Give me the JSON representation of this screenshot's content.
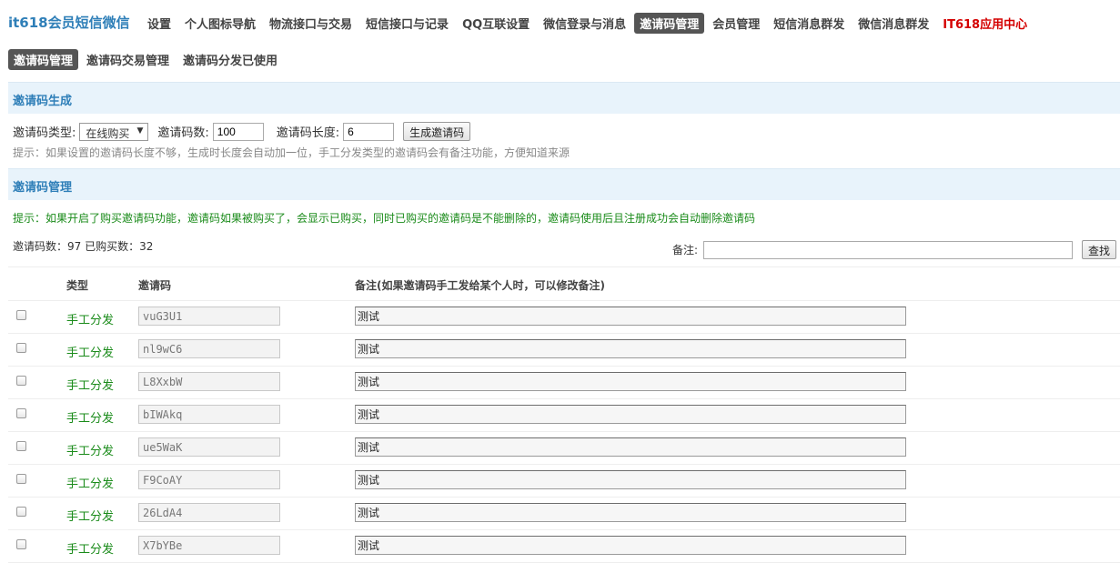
{
  "brand": "it618会员短信微信",
  "nav": [
    {
      "label": "设置",
      "active": false
    },
    {
      "label": "个人图标导航",
      "active": false
    },
    {
      "label": "物流接口与交易",
      "active": false
    },
    {
      "label": "短信接口与记录",
      "active": false
    },
    {
      "label": "QQ互联设置",
      "active": false
    },
    {
      "label": "微信登录与消息",
      "active": false
    },
    {
      "label": "邀请码管理",
      "active": true
    },
    {
      "label": "会员管理",
      "active": false
    },
    {
      "label": "短信消息群发",
      "active": false
    },
    {
      "label": "微信消息群发",
      "active": false
    },
    {
      "label": "IT618应用中心",
      "active": false,
      "highlight": true
    }
  ],
  "subtabs": [
    {
      "label": "邀请码管理",
      "active": true
    },
    {
      "label": "邀请码交易管理",
      "active": false
    },
    {
      "label": "邀请码分发已使用",
      "active": false
    }
  ],
  "generate": {
    "title": "邀请码生成",
    "type_label": "邀请码类型:",
    "type_value": "在线购买",
    "count_label": "邀请码数:",
    "count_value": "100",
    "length_label": "邀请码长度:",
    "length_value": "6",
    "button": "生成邀请码",
    "hint": "提示：如果设置的邀请码长度不够，生成时长度会自动加一位，手工分发类型的邀请码会有备注功能，方便知道来源"
  },
  "manage": {
    "title": "邀请码管理",
    "hint": "提示：如果开启了购买邀请码功能，邀请码如果被购买了，会显示已购买，同时已购买的邀请码是不能删除的，邀请码使用后且注册成功会自动删除邀请码",
    "counts": "邀请码数：97 已购买数：32",
    "remark_label": "备注:",
    "remark_value": "",
    "search_button": "查找"
  },
  "table": {
    "headers": {
      "type": "类型",
      "code": "邀请码",
      "note": "备注(如果邀请码手工发给某个人时，可以修改备注)"
    },
    "rows": [
      {
        "type": "手工分发",
        "code": "vuG3U1",
        "note": "测试"
      },
      {
        "type": "手工分发",
        "code": "nl9wC6",
        "note": "测试"
      },
      {
        "type": "手工分发",
        "code": "L8XxbW",
        "note": "测试"
      },
      {
        "type": "手工分发",
        "code": "bIWAkq",
        "note": "测试"
      },
      {
        "type": "手工分发",
        "code": "ue5WaK",
        "note": "测试"
      },
      {
        "type": "手工分发",
        "code": "F9CoAY",
        "note": "测试"
      },
      {
        "type": "手工分发",
        "code": "26LdA4",
        "note": "测试"
      },
      {
        "type": "手工分发",
        "code": "X7bYBe",
        "note": "测试"
      }
    ]
  }
}
